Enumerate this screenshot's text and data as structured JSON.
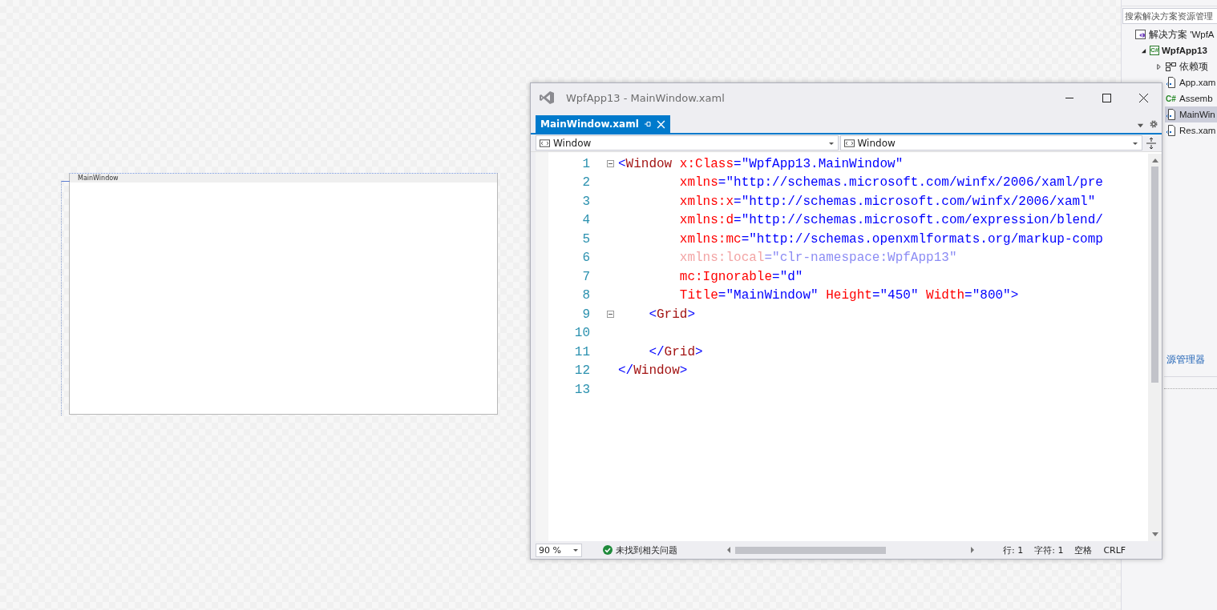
{
  "designer": {
    "window_title": "MainWindow"
  },
  "solution_explorer": {
    "search": {
      "placeholder": "搜索解决方案资源管理"
    },
    "tree": [
      {
        "label": "解决方案 'WpfA",
        "kind": "solution",
        "selected": false,
        "children": [
          {
            "label": "WpfApp13",
            "kind": "project",
            "icon_text": "C#",
            "selected": false,
            "expanded": true,
            "children": [
              {
                "label": "依赖项",
                "kind": "dependencies",
                "selected": false,
                "expanded": false
              },
              {
                "label": "App.xam",
                "kind": "document",
                "selected": false
              },
              {
                "label": "Assemb",
                "kind": "code",
                "icon_text": "C#",
                "selected": false
              },
              {
                "label": "MainWin",
                "kind": "document",
                "selected": true
              },
              {
                "label": "Res.xam",
                "kind": "document",
                "selected": false
              }
            ]
          }
        ]
      }
    ],
    "link": "源管理器"
  },
  "editor_window": {
    "title": "WpfApp13 - MainWindow.xaml",
    "tabs": [
      {
        "label": "MainWindow.xaml",
        "selected": true
      }
    ],
    "nav": [
      "Window",
      "Window"
    ],
    "lines": [
      {
        "number": "1",
        "fold": true,
        "tokens": [
          {
            "kind": "bracket",
            "text": "<"
          },
          {
            "kind": "element",
            "text": "Window"
          },
          {
            "kind": "attribute",
            "text": " x:Class"
          },
          {
            "kind": "bracket",
            "text": "=\"WpfApp13.MainWindow\""
          }
        ]
      },
      {
        "number": "2",
        "fold": false,
        "tokens": [
          {
            "kind": "attribute",
            "text": "        xmlns"
          },
          {
            "kind": "bracket",
            "text": "=\"http://schemas.microsoft.com/winfx/2006/xaml/pre"
          }
        ]
      },
      {
        "number": "3",
        "fold": false,
        "tokens": [
          {
            "kind": "attribute",
            "text": "        xmlns:x"
          },
          {
            "kind": "bracket",
            "text": "=\"http://schemas.microsoft.com/winfx/2006/xaml\""
          }
        ]
      },
      {
        "number": "4",
        "fold": false,
        "tokens": [
          {
            "kind": "attribute",
            "text": "        xmlns:d"
          },
          {
            "kind": "bracket",
            "text": "=\"http://schemas.microsoft.com/expression/blend/"
          }
        ]
      },
      {
        "number": "5",
        "fold": false,
        "tokens": [
          {
            "kind": "attribute",
            "text": "        xmlns:mc"
          },
          {
            "kind": "bracket",
            "text": "=\"http://schemas.openxmlformats.org/markup-comp"
          }
        ]
      },
      {
        "number": "6",
        "fold": false,
        "tokens": [
          {
            "kind": "faded_attribute",
            "text": "        xmlns:local"
          },
          {
            "kind": "faded_value",
            "text": "=\"clr-namespace:WpfApp13\""
          }
        ]
      },
      {
        "number": "7",
        "fold": false,
        "tokens": [
          {
            "kind": "attribute",
            "text": "        mc:Ignorable"
          },
          {
            "kind": "bracket",
            "text": "=\"d\""
          }
        ]
      },
      {
        "number": "8",
        "fold": false,
        "tokens": [
          {
            "kind": "attribute",
            "text": "        Title"
          },
          {
            "kind": "bracket",
            "text": "=\"MainWindow\""
          },
          {
            "kind": "attribute",
            "text": " Height"
          },
          {
            "kind": "bracket",
            "text": "=\"450\""
          },
          {
            "kind": "attribute",
            "text": " Width"
          },
          {
            "kind": "bracket",
            "text": "=\"800\">"
          }
        ]
      },
      {
        "number": "9",
        "fold": true,
        "tokens": [
          {
            "kind": "bracket",
            "text": "    <"
          },
          {
            "kind": "element",
            "text": "Grid"
          },
          {
            "kind": "bracket",
            "text": ">"
          }
        ]
      },
      {
        "number": "10",
        "fold": false
      },
      {
        "number": "11",
        "fold": false,
        "tokens": [
          {
            "kind": "bracket",
            "text": "    </"
          },
          {
            "kind": "element",
            "text": "Grid"
          },
          {
            "kind": "bracket",
            "text": ">"
          }
        ]
      },
      {
        "number": "12",
        "fold": false,
        "tokens": [
          {
            "kind": "bracket",
            "text": "</"
          },
          {
            "kind": "element",
            "text": "Window"
          },
          {
            "kind": "bracket",
            "text": ">"
          }
        ]
      },
      {
        "number": "13",
        "fold": false
      }
    ],
    "status_bar": {
      "zoom": "90 %",
      "issues": "未找到相关问题",
      "line": "行: 1",
      "char": "字符: 1",
      "indent": "空格",
      "eol": "CRLF"
    }
  }
}
